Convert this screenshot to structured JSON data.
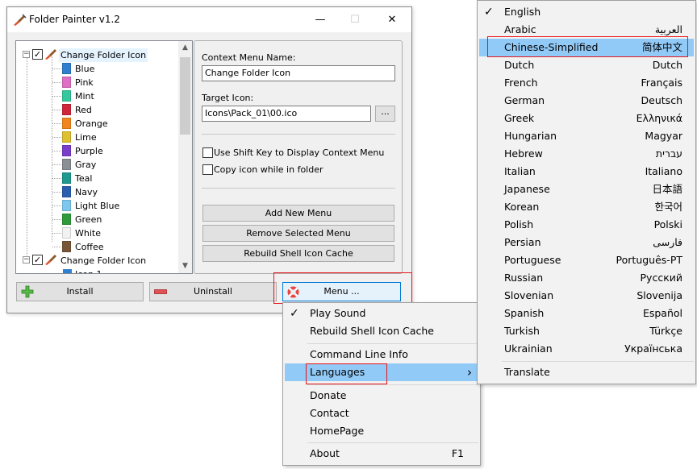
{
  "window": {
    "title": "Folder Painter v1.2",
    "minimize": "—",
    "maximize": "☐",
    "close": "✕"
  },
  "tree": {
    "root_label": "Change Folder Icon",
    "items": [
      {
        "label": "Blue",
        "color": "#2f7fd0"
      },
      {
        "label": "Pink",
        "color": "#de6fc4"
      },
      {
        "label": "Mint",
        "color": "#34c89c"
      },
      {
        "label": "Red",
        "color": "#d0253b"
      },
      {
        "label": "Orange",
        "color": "#f0861d"
      },
      {
        "label": "Lime",
        "color": "#dfc030"
      },
      {
        "label": "Purple",
        "color": "#7a3dcc"
      },
      {
        "label": "Gray",
        "color": "#8a8f96"
      },
      {
        "label": "Teal",
        "color": "#1e9a8f"
      },
      {
        "label": "Navy",
        "color": "#2a5fb0"
      },
      {
        "label": "Light Blue",
        "color": "#7ec8f0"
      },
      {
        "label": "Green",
        "color": "#2d9b3a"
      },
      {
        "label": "White",
        "color": "#f2f2f2"
      },
      {
        "label": "Coffee",
        "color": "#7a5638"
      }
    ],
    "second_root_label": "Change Folder Icon",
    "partial_item_label": "Icon 1"
  },
  "panel": {
    "context_menu_name_label": "Context Menu Name:",
    "context_menu_name_value": "Change Folder Icon",
    "target_icon_label": "Target Icon:",
    "target_icon_value": "Icons\\Pack_01\\00.ico",
    "browse_label": "...",
    "shift_key_label": "Use Shift Key to Display Context Menu",
    "copy_icon_label": "Copy icon while in folder",
    "add_new_menu": "Add New Menu",
    "remove_selected_menu": "Remove Selected Menu",
    "rebuild_cache": "Rebuild Shell Icon Cache"
  },
  "bottom": {
    "install": "Install",
    "uninstall": "Uninstall",
    "menu": "Menu ..."
  },
  "main_menu": {
    "items": [
      {
        "label": "Play Sound",
        "checked": true
      },
      {
        "label": "Rebuild Shell Icon Cache"
      },
      {
        "label": "Command Line Info"
      },
      {
        "label": "Languages",
        "arrow": "›"
      },
      {
        "label": "Donate"
      },
      {
        "label": "Contact"
      },
      {
        "label": "HomePage"
      },
      {
        "label": "About",
        "shortcut": "F1"
      }
    ]
  },
  "languages_menu": {
    "items": [
      {
        "label": "English",
        "native": "",
        "checked": true
      },
      {
        "label": "Arabic",
        "native": "العربية"
      },
      {
        "label": "Chinese-Simplified",
        "native": "简体中文"
      },
      {
        "label": "Dutch",
        "native": "Dutch"
      },
      {
        "label": "French",
        "native": "Français"
      },
      {
        "label": "German",
        "native": "Deutsch"
      },
      {
        "label": "Greek",
        "native": "Ελληνικά"
      },
      {
        "label": "Hungarian",
        "native": "Magyar"
      },
      {
        "label": "Hebrew",
        "native": "עברית"
      },
      {
        "label": "Italian",
        "native": "Italiano"
      },
      {
        "label": "Japanese",
        "native": "日本語"
      },
      {
        "label": "Korean",
        "native": "한국어"
      },
      {
        "label": "Polish",
        "native": "Polski"
      },
      {
        "label": "Persian",
        "native": "فارسی"
      },
      {
        "label": "Portuguese",
        "native": "Português-PT"
      },
      {
        "label": "Russian",
        "native": "Русский"
      },
      {
        "label": "Slovenian",
        "native": "Slovenija"
      },
      {
        "label": "Spanish",
        "native": "Español"
      },
      {
        "label": "Turkish",
        "native": "Türkçe"
      },
      {
        "label": "Ukrainian",
        "native": "Українська"
      },
      {
        "label": "Translate",
        "native": ""
      }
    ]
  },
  "colors": {
    "highlight": "#91c9f7",
    "annotation_red": "#e5161b",
    "menu_button_border": "#0078d7"
  }
}
